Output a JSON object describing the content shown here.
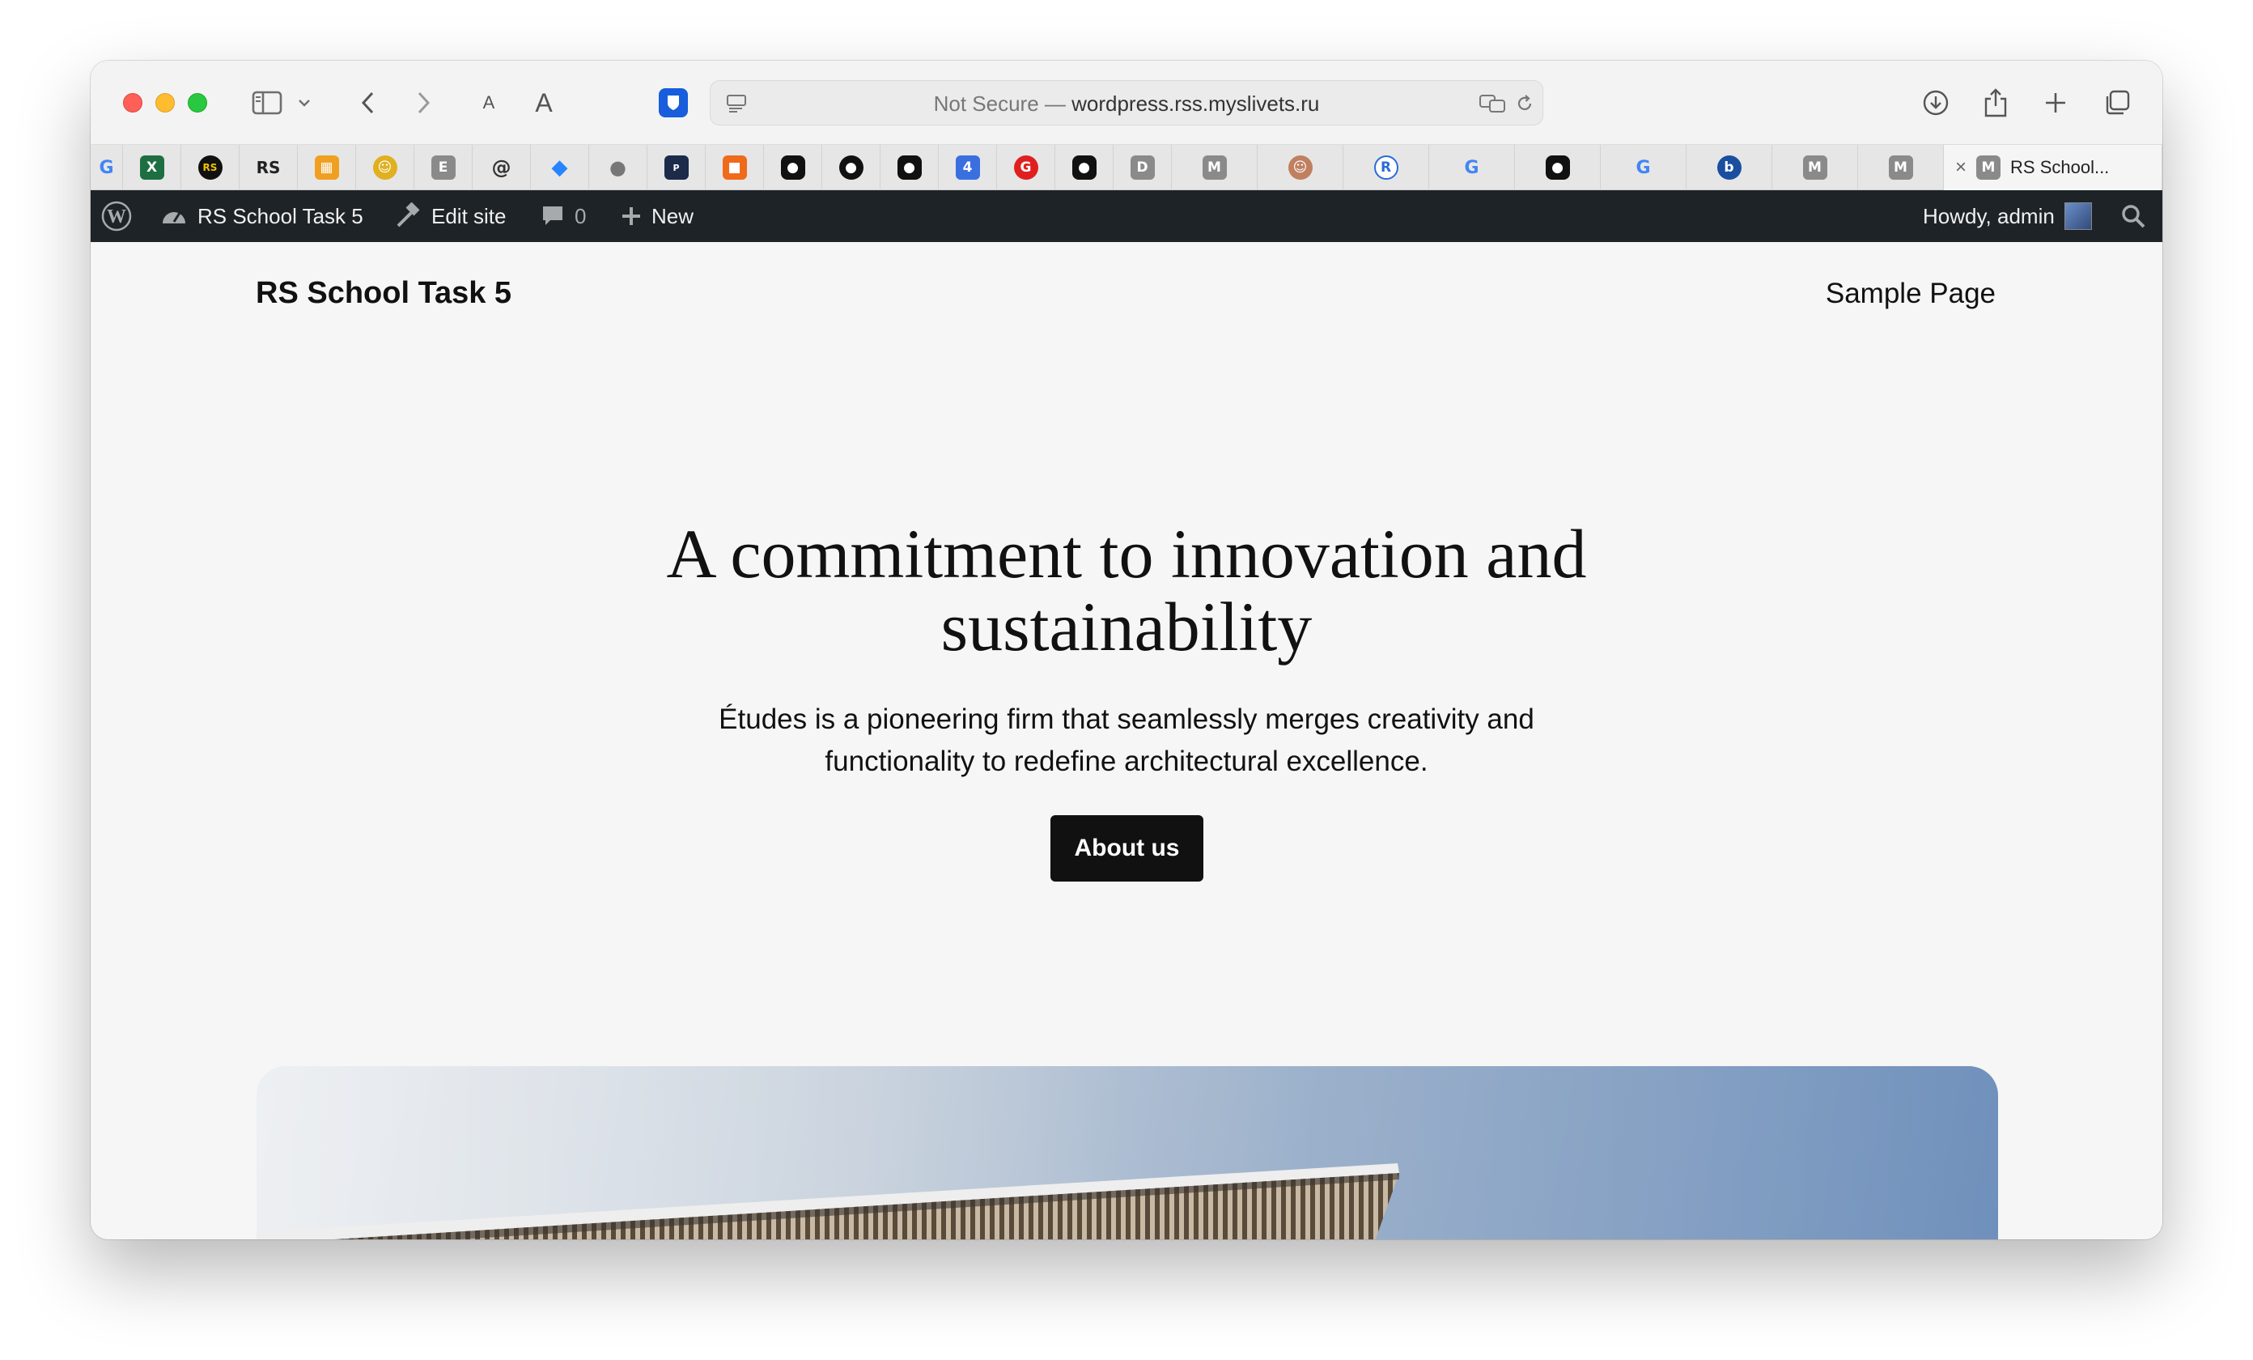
{
  "browser": {
    "address_text": "wordpress.rss.myslivets.ru",
    "security_label": "Not Secure — ",
    "font_small_label": "A",
    "font_large_label": "A"
  },
  "tabs": {
    "pinned": [
      {
        "icon": "google-icon",
        "letter": "G",
        "color": "#4285f4"
      },
      {
        "icon": "excel-icon",
        "letter": "X",
        "color": "#1d6f42"
      },
      {
        "icon": "rs-circle-icon",
        "letter": "RS",
        "color": "#111111"
      },
      {
        "icon": "rs-text-icon",
        "letter": "RS",
        "color": "#222222"
      },
      {
        "icon": "calendar-icon",
        "letter": "▦",
        "color": "#f0a020"
      },
      {
        "icon": "mascot-icon",
        "letter": "☺",
        "color": "#e0b020"
      },
      {
        "icon": "e-icon",
        "letter": "E",
        "color": "#8a8a8a"
      },
      {
        "icon": "spiral-icon",
        "letter": "@",
        "color": "#333333"
      },
      {
        "icon": "jira-icon",
        "letter": "◆",
        "color": "#2684ff"
      },
      {
        "icon": "apple-icon",
        "letter": "",
        "color": "#777777"
      },
      {
        "icon": "polizei-icon",
        "letter": "P",
        "color": "#1c2b4a"
      },
      {
        "icon": "cube-icon",
        "letter": "■",
        "color": "#f06a1c"
      },
      {
        "icon": "github-icon",
        "letter": "●",
        "color": "#111111"
      },
      {
        "icon": "github-icon",
        "letter": "●",
        "color": "#111111"
      },
      {
        "icon": "github-icon",
        "letter": "●",
        "color": "#111111"
      },
      {
        "icon": "four-icon",
        "letter": "4",
        "color": "#3a6fe0"
      },
      {
        "icon": "red-g-icon",
        "letter": "G",
        "color": "#e02020"
      },
      {
        "icon": "github-icon",
        "letter": "●",
        "color": "#111111"
      },
      {
        "icon": "d-icon",
        "letter": "D",
        "color": "#8a8a8a"
      },
      {
        "icon": "m-icon",
        "letter": "M",
        "color": "#8a8a8a"
      },
      {
        "icon": "avatar-icon",
        "letter": "☺",
        "color": "#c08060"
      },
      {
        "icon": "r-icon",
        "letter": "R",
        "color": "#2a6bd8"
      },
      {
        "icon": "google-icon",
        "letter": "G",
        "color": "#4285f4"
      },
      {
        "icon": "github-icon",
        "letter": "●",
        "color": "#111111"
      },
      {
        "icon": "google-icon",
        "letter": "G",
        "color": "#4285f4"
      },
      {
        "icon": "b-icon",
        "letter": "b",
        "color": "#1a4fa0"
      },
      {
        "icon": "m-icon",
        "letter": "M",
        "color": "#8a8a8a"
      },
      {
        "icon": "m-icon",
        "letter": "M",
        "color": "#8a8a8a"
      }
    ],
    "active_title": "RS School...",
    "active_fav_letter": "M"
  },
  "adminbar": {
    "site_name": "RS School Task 5",
    "edit_site": "Edit site",
    "comments_count": "0",
    "new_label": "New",
    "howdy": "Howdy, admin"
  },
  "page": {
    "site_title": "RS School Task 5",
    "nav_link": "Sample Page",
    "hero_heading": "A commitment to innovation and sustainability",
    "hero_text": "Études is a pioneering firm that seamlessly merges creativity and functionality to redefine architectural excellence.",
    "button_label": "About us"
  }
}
